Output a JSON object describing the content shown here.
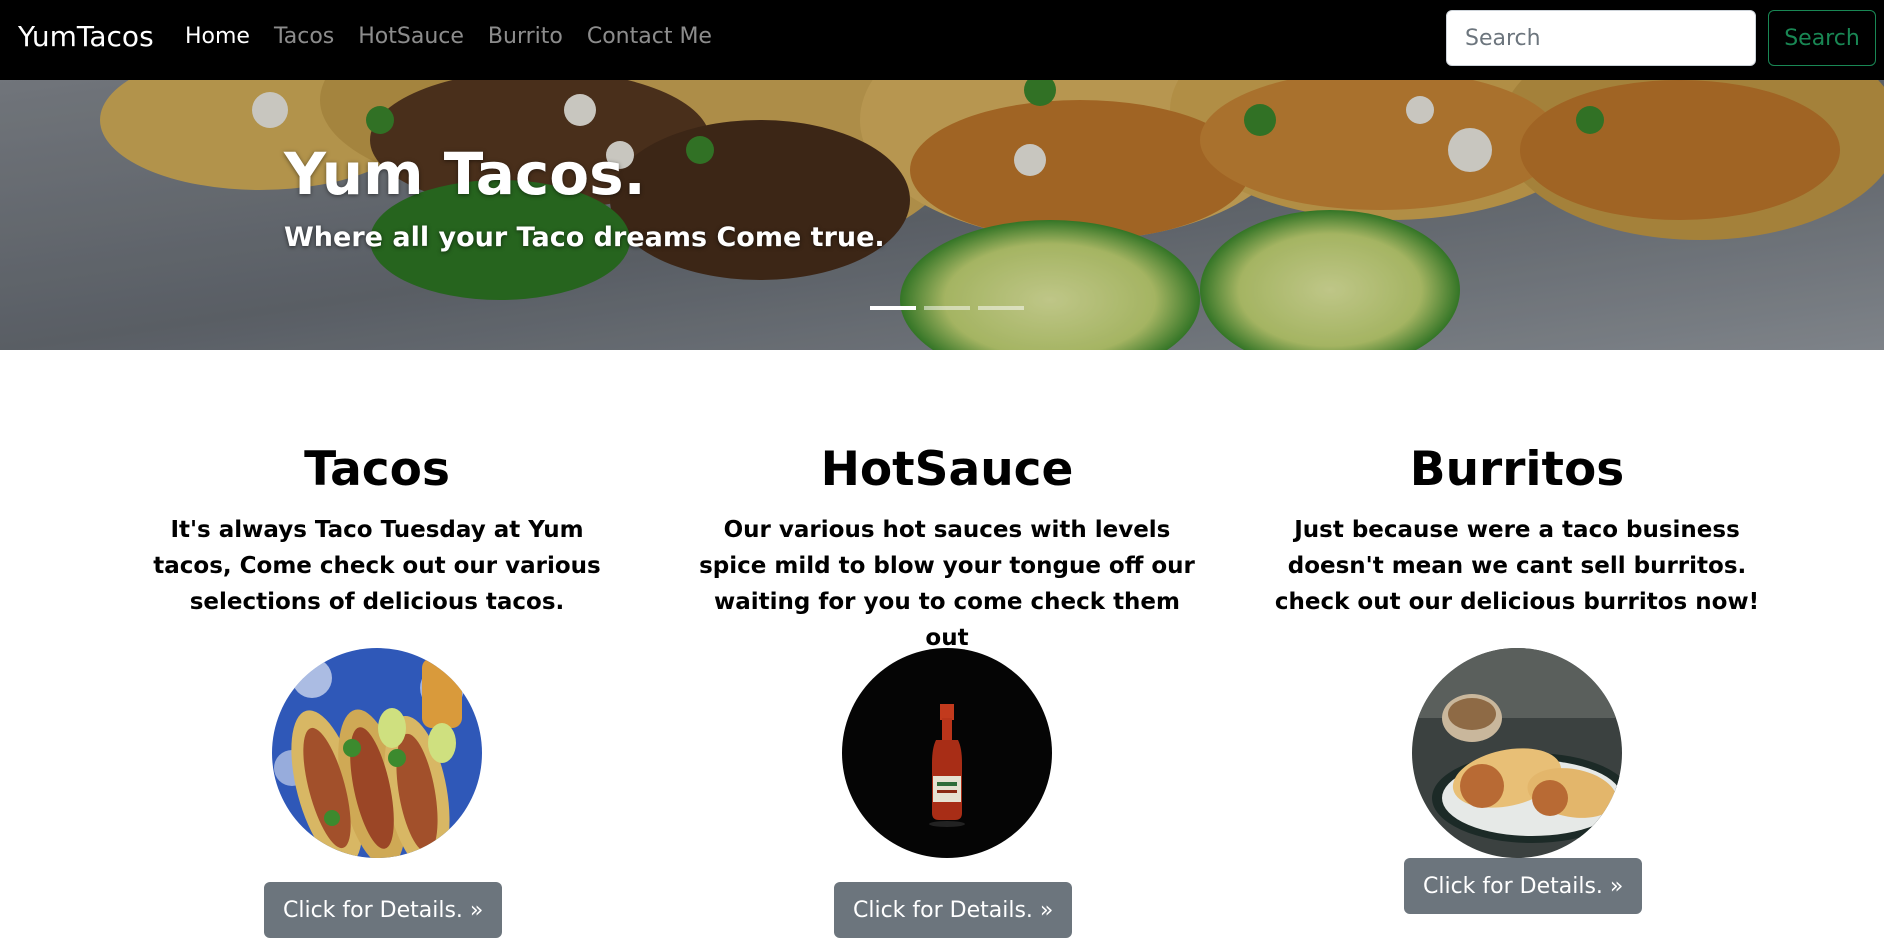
{
  "navbar": {
    "brand": "YumTacos",
    "links": [
      "Home",
      "Tacos",
      "HotSauce",
      "Burrito",
      "Contact Me"
    ],
    "search_placeholder": "Search",
    "search_button": "Search"
  },
  "hero": {
    "title": "Yum Tacos.",
    "subtitle": "Where all your Taco dreams Come true.",
    "slide_count": 3,
    "active_slide": 1
  },
  "columns": [
    {
      "heading": "Tacos",
      "text": "It's always Taco Tuesday at Yum tacos, Come check out our various selections of delicious tacos.",
      "button": "Click for Details. »"
    },
    {
      "heading": "HotSauce",
      "text": "Our various hot sauces with levels spice mild to blow your tongue off our waiting for you to come check them out",
      "button": "Click for Details. »"
    },
    {
      "heading": "Burritos",
      "text": "Just because were a taco business doesn't mean we cant sell burritos. check out our delicious burritos now!",
      "button": "Click for Details. »"
    }
  ],
  "colors": {
    "navbar_bg": "#000000",
    "search_button": "#198754",
    "details_button": "#6c757d"
  }
}
